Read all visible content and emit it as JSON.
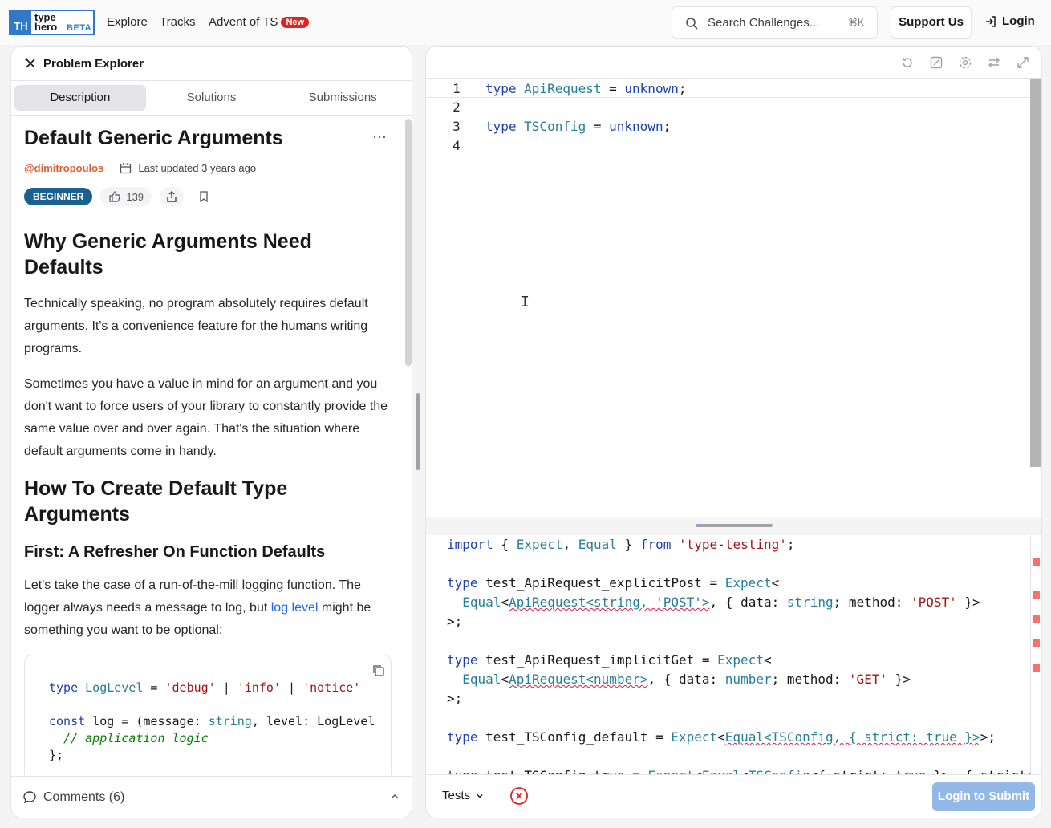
{
  "nav": {
    "logo_th": "TH",
    "logo_line1": "type",
    "logo_line2": "hero",
    "logo_beta": "BETA",
    "links": [
      "Explore",
      "Tracks",
      "Advent of TS"
    ],
    "new_badge": "New",
    "search_placeholder": "Search Challenges...",
    "search_shortcut": "⌘K",
    "support": "Support Us",
    "login": "Login"
  },
  "left": {
    "header": "Problem Explorer",
    "tabs": [
      "Description",
      "Solutions",
      "Submissions"
    ],
    "active_tab": "Description",
    "title": "Default Generic Arguments",
    "author": "@dimitropoulos",
    "updated": "Last updated 3 years ago",
    "difficulty": "BEGINNER",
    "likes": "139",
    "h2_1": "Why Generic Arguments Need Defaults",
    "p1": "Technically speaking, no program absolutely requires default arguments. It's a convenience feature for the humans writing programs.",
    "p2": "Sometimes you have a value in mind for an argument and you don't want to force users of your library to constantly provide the same value over and over again. That's the situation where default arguments come in handy.",
    "h2_2": "How To Create Default Type Arguments",
    "h3_1": "First: A Refresher On Function Defaults",
    "p3_a": "Let's take the case of a run-of-the-mill logging function. The logger always needs a message to log, but ",
    "p3_link": "log level",
    "p3_b": " might be something you want to be optional:",
    "comments": "Comments (6)"
  },
  "editor": {
    "line_numbers": [
      "1",
      "2",
      "3",
      "4"
    ],
    "lines": [
      "type ApiRequest = unknown;",
      "",
      "type TSConfig = unknown;",
      ""
    ]
  },
  "footer": {
    "tests_label": "Tests",
    "submit": "Login to Submit"
  },
  "colors": {
    "brand": "#3178c6",
    "author": "#e35d36",
    "beginner": "#1a6091",
    "submit_disabled": "#93b8e6",
    "error": "#e11d48"
  }
}
